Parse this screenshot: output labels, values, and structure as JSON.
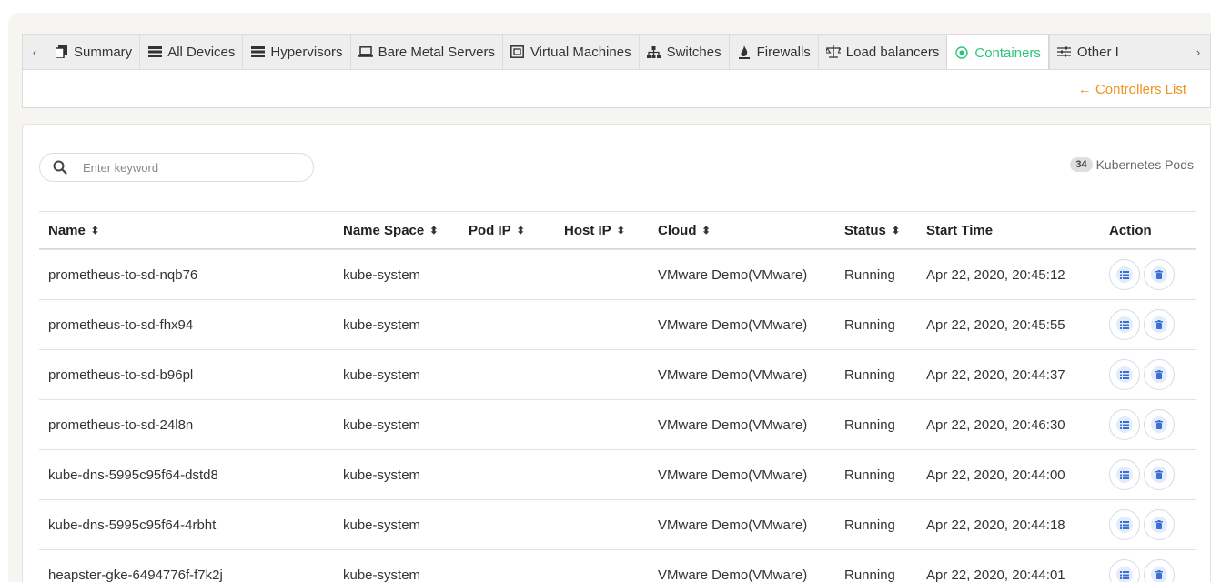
{
  "tabs": {
    "left_arrow": "‹",
    "right_arrow": "›",
    "items": [
      {
        "label": "Summary",
        "icon": "summary-icon"
      },
      {
        "label": "All Devices",
        "icon": "server-stack-icon"
      },
      {
        "label": "Hypervisors",
        "icon": "server-stack-icon"
      },
      {
        "label": "Bare Metal Servers",
        "icon": "laptop-icon"
      },
      {
        "label": "Virtual Machines",
        "icon": "vm-icon"
      },
      {
        "label": "Switches",
        "icon": "network-icon"
      },
      {
        "label": "Firewalls",
        "icon": "fire-icon"
      },
      {
        "label": "Load balancers",
        "icon": "scale-icon"
      },
      {
        "label": "Containers",
        "icon": "container-icon",
        "active": true
      },
      {
        "label": "Other I",
        "icon": "sliders-icon"
      }
    ]
  },
  "subbar": {
    "controllers_link": "← Controllers List"
  },
  "search": {
    "placeholder": "Enter keyword"
  },
  "summary": {
    "count": "34",
    "label": "Kubernetes Pods"
  },
  "table": {
    "headers": {
      "name": "Name",
      "namespace": "Name Space",
      "pod_ip": "Pod IP",
      "host_ip": "Host IP",
      "cloud": "Cloud",
      "status": "Status",
      "start_time": "Start Time",
      "action": "Action"
    },
    "sort_glyph": "⬍",
    "rows": [
      {
        "name": "prometheus-to-sd-nqb76",
        "namespace": "kube-system",
        "pod_ip": "",
        "host_ip": "",
        "cloud": "VMware Demo(VMware)",
        "status": "Running",
        "start_time": "Apr 22, 2020, 20:45:12"
      },
      {
        "name": "prometheus-to-sd-fhx94",
        "namespace": "kube-system",
        "pod_ip": "",
        "host_ip": "",
        "cloud": "VMware Demo(VMware)",
        "status": "Running",
        "start_time": "Apr 22, 2020, 20:45:55"
      },
      {
        "name": "prometheus-to-sd-b96pl",
        "namespace": "kube-system",
        "pod_ip": "",
        "host_ip": "",
        "cloud": "VMware Demo(VMware)",
        "status": "Running",
        "start_time": "Apr 22, 2020, 20:44:37"
      },
      {
        "name": "prometheus-to-sd-24l8n",
        "namespace": "kube-system",
        "pod_ip": "",
        "host_ip": "",
        "cloud": "VMware Demo(VMware)",
        "status": "Running",
        "start_time": "Apr 22, 2020, 20:46:30"
      },
      {
        "name": "kube-dns-5995c95f64-dstd8",
        "namespace": "kube-system",
        "pod_ip": "",
        "host_ip": "",
        "cloud": "VMware Demo(VMware)",
        "status": "Running",
        "start_time": "Apr 22, 2020, 20:44:00"
      },
      {
        "name": "kube-dns-5995c95f64-4rbht",
        "namespace": "kube-system",
        "pod_ip": "",
        "host_ip": "",
        "cloud": "VMware Demo(VMware)",
        "status": "Running",
        "start_time": "Apr 22, 2020, 20:44:18"
      },
      {
        "name": "heapster-gke-6494776f-f7k2j",
        "namespace": "kube-system",
        "pod_ip": "",
        "host_ip": "",
        "cloud": "VMware Demo(VMware)",
        "status": "Running",
        "start_time": "Apr 22, 2020, 20:44:01"
      }
    ]
  },
  "colors": {
    "active_tab": "#2ec47a",
    "link": "#f0941e",
    "action_icon": "#3b6fd4"
  }
}
